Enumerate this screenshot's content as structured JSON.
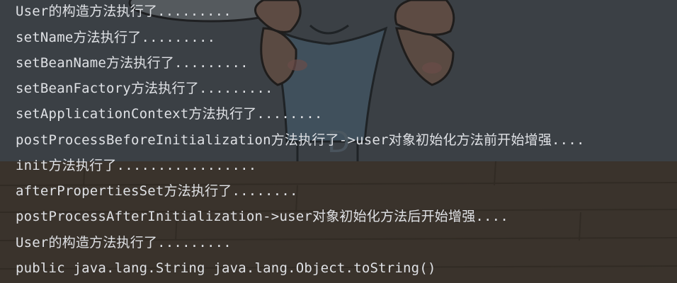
{
  "console": {
    "lines": [
      "User的构造方法执行了.........",
      "setName方法执行了.........",
      "setBeanName方法执行了.........",
      "setBeanFactory方法执行了.........",
      "setApplicationContext方法执行了........",
      "postProcessBeforeInitialization方法执行了->user对象初始化方法前开始增强....",
      "init方法执行了.................",
      "afterPropertiesSet方法执行了........",
      "postProcessAfterInitialization->user对象初始化方法后开始增强....",
      "User的构造方法执行了.........",
      "public java.lang.String java.lang.Object.toString()"
    ]
  },
  "colors": {
    "text": "#dfe1e5",
    "background": "#2b2d30"
  }
}
